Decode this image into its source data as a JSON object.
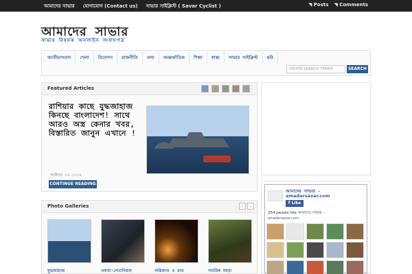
{
  "topbar": {
    "links": [
      "আমাদের সাভার",
      "যোগাযোগ (Contact us)",
      "সাভার সাইক্লিস্ট ( Savar Cyclist )"
    ],
    "feeds": [
      "Posts",
      "Comments"
    ]
  },
  "header": {
    "title": "আমাদের সাভার",
    "tagline": "সাভার বিষয়ক অনলাইন সংবাদপত্র"
  },
  "nav": {
    "items": [
      "জাতীয়সংবাদ",
      "খেলা",
      "বিনোদন",
      "রাজনীতি",
      "তথ্য",
      "আন্তর্জাতিক",
      "শিক্ষা",
      "স্বাস্থ্য",
      "সাভার সাইক্লিস্ট",
      "ছবি"
    ],
    "search_placeholder": "ENTER SEARCH TERMS",
    "search_button": "SEARCH"
  },
  "featured": {
    "heading": "Featured Articles",
    "title": "রাশিয়ার কাছে যুদ্ধজাহাজ কিনছে বাংলাদেশ! সাথে আরও অস্ত্র কেনার খবর, বিস্তারিত জানুন এখানে !",
    "meta": "অক্টোবর ০৫,২০১৪",
    "continue_label": "CONTINUE READING"
  },
  "galleries": {
    "heading": "Photo Galleries",
    "prev": "‹",
    "next": "›",
    "items": [
      {
        "caption": "যুদ্ধজাহাজ"
      },
      {
        "caption": "ওবামা-নেতানিয়াহু"
      },
      {
        "caption": "অগ্নিকাণ্ড ও রাত"
      },
      {
        "caption": "সামরিক মহড়া"
      }
    ]
  },
  "facebook": {
    "page_name": "আমাদের সাভার -",
    "site": "amadersavar.com",
    "like_label": "Like",
    "count_text": "254 people like আমাদের সাভার -",
    "count_site": "amadersavar.com."
  }
}
